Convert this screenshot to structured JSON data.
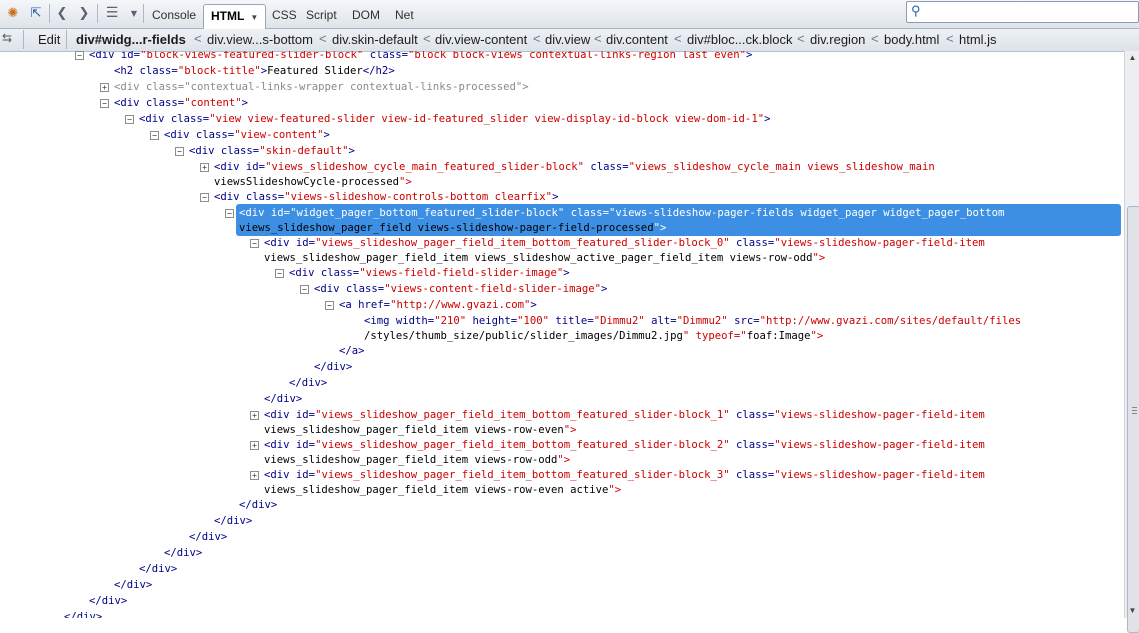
{
  "toolbar": {
    "icons": [
      "firebug-icon",
      "inspect-icon",
      "back-arrow-icon",
      "forward-arrow-icon",
      "menu-icon"
    ],
    "tabs": [
      {
        "label": "Console"
      },
      {
        "label": "HTML"
      },
      {
        "label": "CSS"
      },
      {
        "label": "Script"
      },
      {
        "label": "DOM"
      },
      {
        "label": "Net"
      }
    ],
    "active_tab": "HTML",
    "search_placeholder": ""
  },
  "breadcrumb": {
    "edit_label": "Edit",
    "items": [
      "div#widg...r-fields",
      "div.view...s-bottom",
      "div.skin-default",
      "div.view-content",
      "div.view",
      "div.content",
      "div#bloc...ck.block",
      "div.region",
      "body.html",
      "html.js"
    ]
  },
  "tree": {
    "lines": [
      "<div id=\"block-views-featured-slider-block\" class=\"block block-views contextual-links-region last even\">",
      "<h2 class=\"block-title\">Featured Slider</h2>",
      "<div class=\"contextual-links-wrapper contextual-links-processed\">",
      "<div class=\"content\">",
      "<div class=\"view view-featured-slider view-id-featured_slider view-display-id-block view-dom-id-1\">",
      "<div class=\"view-content\">",
      "<div class=\"skin-default\">",
      "<div id=\"views_slideshow_cycle_main_featured_slider-block\" class=\"views_slideshow_cycle_main views_slideshow_main",
      "viewsSlideshowCycle-processed\">",
      "<div class=\"views-slideshow-controls-bottom clearfix\">",
      "<div id=\"widget_pager_bottom_featured_slider-block\" class=\"views-slideshow-pager-fields widget_pager widget_pager_bottom",
      "views_slideshow_pager_field views-slideshow-pager-field-processed\">",
      "<div id=\"views_slideshow_pager_field_item_bottom_featured_slider-block_0\" class=\"views-slideshow-pager-field-item",
      "views_slideshow_pager_field_item views_slideshow_active_pager_field_item views-row-odd\">",
      "<div class=\"views-field-field-slider-image\">",
      "<div class=\"views-content-field-slider-image\">",
      "<a href=\"http://www.gvazi.com\">",
      "<img width=\"210\" height=\"100\" title=\"Dimmu2\" alt=\"Dimmu2\" src=\"http://www.gvazi.com/sites/default/files",
      "/styles/thumb_size/public/slider_images/Dimmu2.jpg\" typeof=\"foaf:Image\">",
      "</a>",
      "</div>",
      "</div>",
      "</div>",
      "<div id=\"views_slideshow_pager_field_item_bottom_featured_slider-block_1\" class=\"views-slideshow-pager-field-item",
      "views_slideshow_pager_field_item views-row-even\">",
      "<div id=\"views_slideshow_pager_field_item_bottom_featured_slider-block_2\" class=\"views-slideshow-pager-field-item",
      "views_slideshow_pager_field_item views-row-odd\">",
      "<div id=\"views_slideshow_pager_field_item_bottom_featured_slider-block_3\" class=\"views-slideshow-pager-field-item",
      "views_slideshow_pager_field_item views-row-even active\">",
      "</div>",
      "</div>",
      "</div>",
      "</div>",
      "</div>",
      "</div>",
      "</div>",
      "</div>",
      "</div>"
    ]
  },
  "colors": {
    "tag": "#000088",
    "attr_value": "#cc0000",
    "selection": "#3d8fe3"
  }
}
